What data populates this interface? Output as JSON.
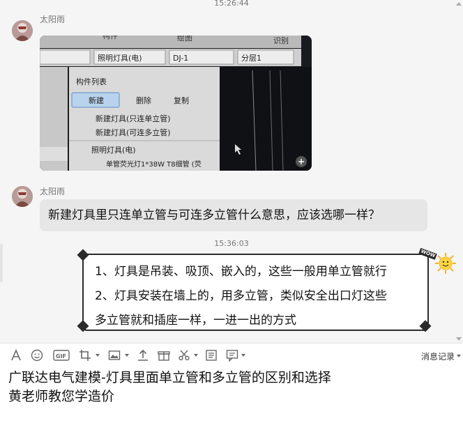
{
  "timestamps": [
    "15:26:44",
    "15:36:03"
  ],
  "messages": [
    {
      "sender": "太阳雨"
    },
    {
      "sender": "太阳雨",
      "text": "新建灯具里只连单立管与可连多立管什么意思，应该选哪一样？"
    }
  ],
  "photo": {
    "top_labels": [
      "构件",
      "绘图",
      "识别"
    ],
    "dropdowns": [
      "照明灯具(电)",
      "DJ-1",
      "分层1"
    ],
    "panel_title": "构件列表",
    "buttons": {
      "new": "新建",
      "delete": "删除",
      "copy": "复制"
    },
    "menu_items": [
      "新建灯具(只连单立管)",
      "新建灯具(可连多立管)"
    ],
    "tree_group": "照明灯具(电)",
    "tree_item": "单管荧光灯1*38W T8细管 (荧"
  },
  "reply": {
    "lines": [
      "1、灯具是吊装、吸顶、嵌入的，这些一般用单立管就行",
      "2、灯具安装在墙上的，用多立管，类似安全出口灯这些",
      "多立管就和插座一样，一进一出的方式"
    ],
    "badge": "WOW"
  },
  "toolbar": {
    "icons": [
      "font-icon",
      "emoji-icon",
      "gif-icon",
      "screenshot-icon",
      "image-icon",
      "upload-icon",
      "gift-icon",
      "scissors-icon",
      "document-icon",
      "message-icon"
    ],
    "history_label": "消息记录"
  },
  "input": {
    "lines": [
      "广联达电气建模-灯具里面单立管和多立管的区别和选择",
      "黄老师教您学造价"
    ]
  }
}
